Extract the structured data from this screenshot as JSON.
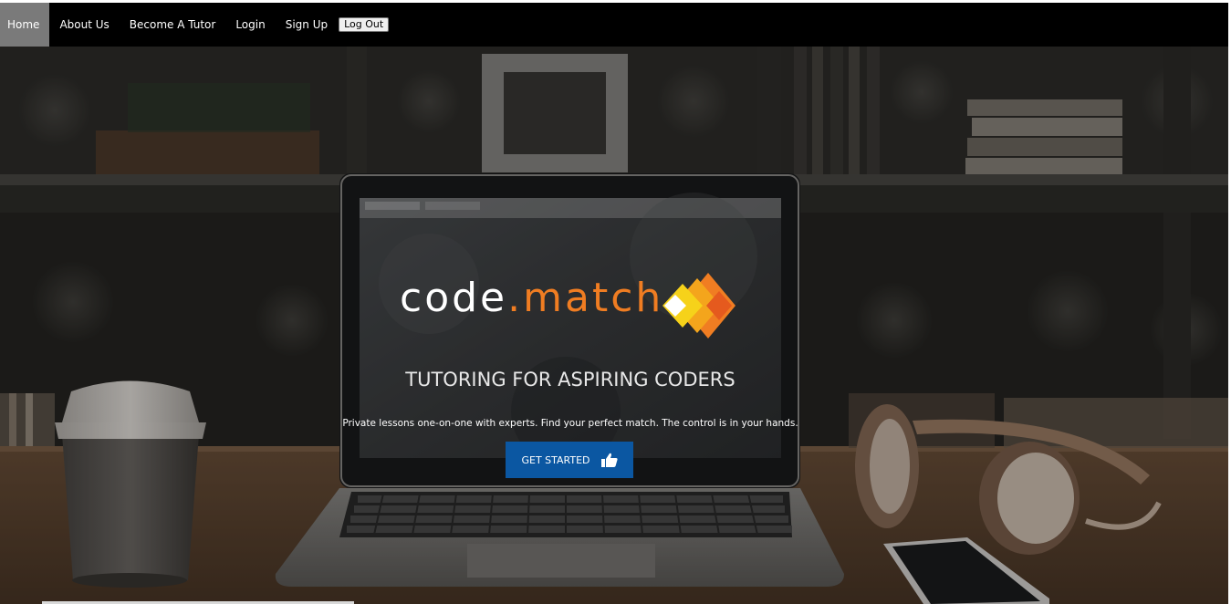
{
  "nav": {
    "items": [
      {
        "label": "Home",
        "active": true
      },
      {
        "label": "About Us",
        "active": false
      },
      {
        "label": "Become A Tutor",
        "active": false
      },
      {
        "label": "Login",
        "active": false
      },
      {
        "label": "Sign Up",
        "active": false
      }
    ],
    "logout_label": "Log Out"
  },
  "hero": {
    "logo": {
      "code": "code",
      "dot": ".",
      "match": "match",
      "code_color": "#ffffff",
      "match_color": "#f07d22"
    },
    "tagline": "TUTORING FOR ASPIRING CODERS",
    "subtitle": "Private lessons one-on-one with experts. Find your perfect match. The control is in your hands.",
    "cta_label": "GET STARTED",
    "cta_icon": "thumbs-up-icon",
    "cta_color": "#0b57a2"
  },
  "colors": {
    "navbar_bg": "#000000",
    "nav_active_bg": "#7a7a7a"
  }
}
